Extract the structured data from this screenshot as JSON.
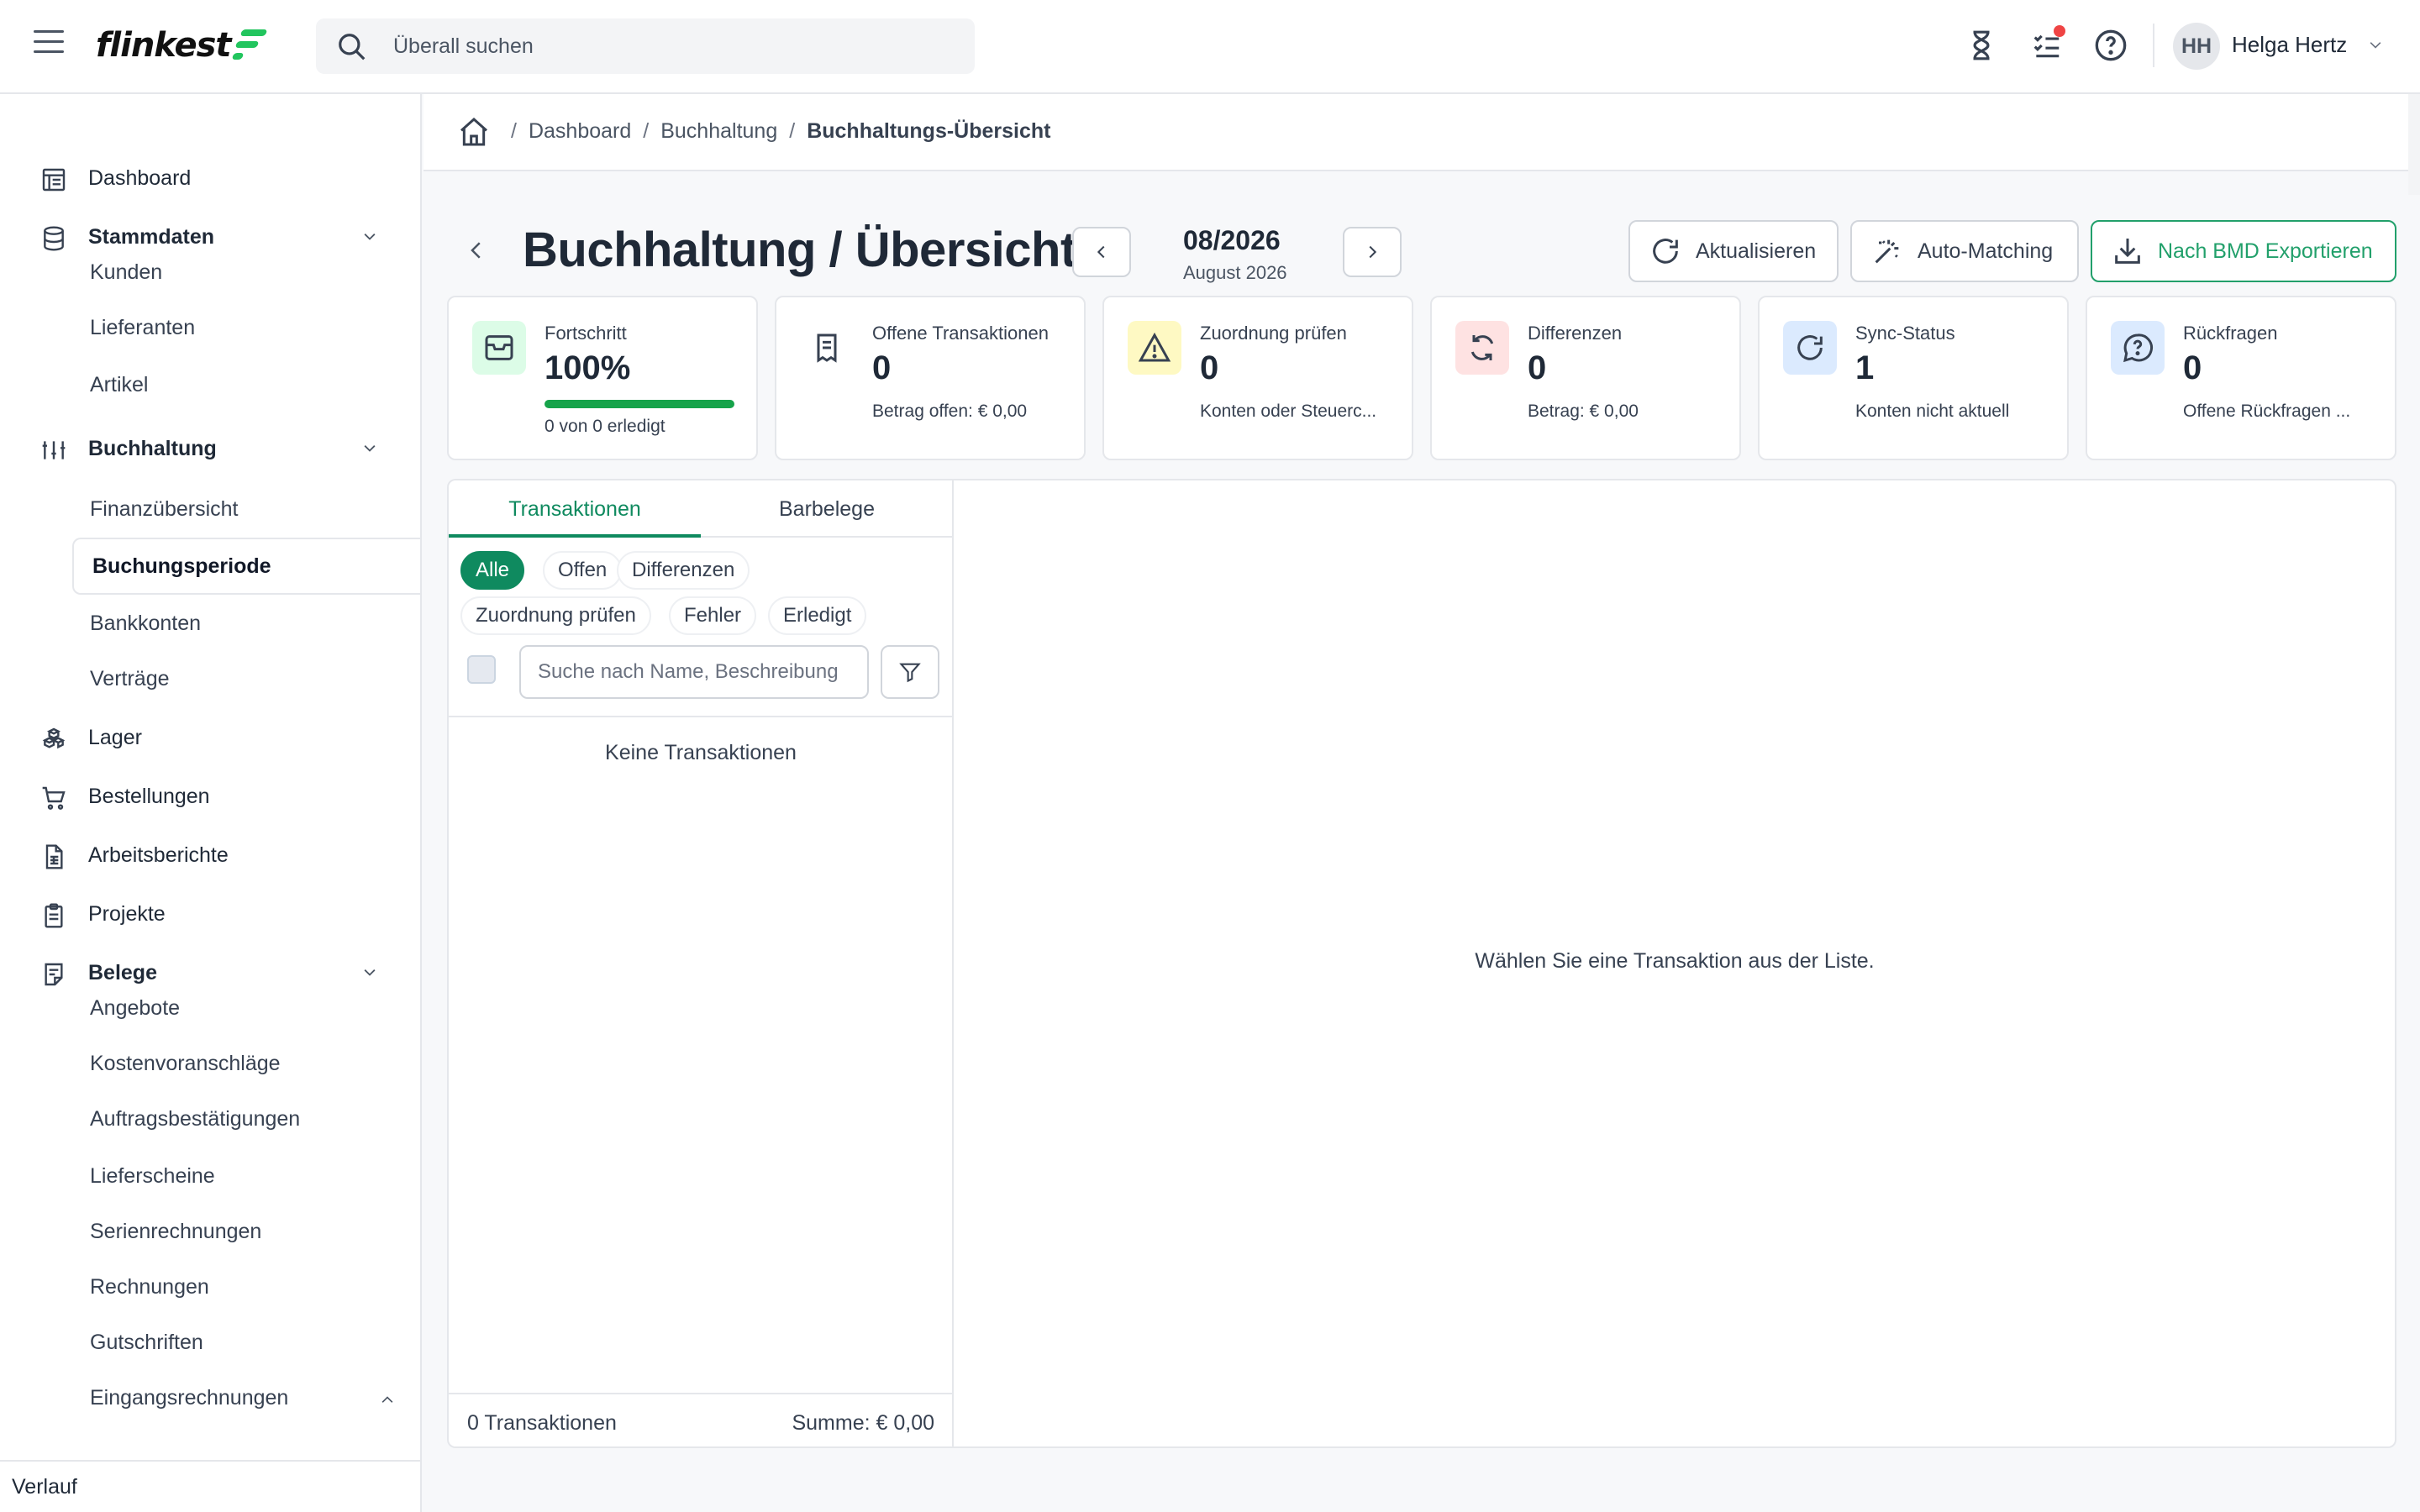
{
  "header": {
    "logo_text": "flinkest",
    "search_placeholder": "Überall suchen",
    "user_initials": "HH",
    "user_name": "Helga Hertz"
  },
  "sidebar": {
    "items": [
      {
        "label": "Dashboard",
        "icon": "dashboard-icon"
      },
      {
        "label": "Stammdaten",
        "icon": "database-icon",
        "expanded": true
      },
      {
        "label": "Kunden"
      },
      {
        "label": "Lieferanten"
      },
      {
        "label": "Artikel"
      },
      {
        "label": "Buchhaltung",
        "icon": "sliders-icon",
        "expanded": true
      },
      {
        "label": "Finanzübersicht"
      },
      {
        "label": "Buchungsperiode",
        "active": true
      },
      {
        "label": "Bankkonten"
      },
      {
        "label": "Verträge"
      },
      {
        "label": "Lager",
        "icon": "boxes-icon"
      },
      {
        "label": "Bestellungen",
        "icon": "cart-icon"
      },
      {
        "label": "Arbeitsberichte",
        "icon": "report-icon"
      },
      {
        "label": "Projekte",
        "icon": "clipboard-icon"
      },
      {
        "label": "Belege",
        "icon": "receipt-icon",
        "expanded": true
      },
      {
        "label": "Angebote"
      },
      {
        "label": "Kostenvoranschläge"
      },
      {
        "label": "Auftragsbestätigungen"
      },
      {
        "label": "Lieferscheine"
      },
      {
        "label": "Serienrechnungen"
      },
      {
        "label": "Rechnungen"
      },
      {
        "label": "Gutschriften"
      },
      {
        "label": "Eingangsrechnungen"
      }
    ],
    "footer_label": "Verlauf"
  },
  "breadcrumb": {
    "items": [
      "Dashboard",
      "Buchhaltung",
      "Buchhaltungs-Übersicht"
    ],
    "separator": "/"
  },
  "page": {
    "title": "Buchhaltung / Übersicht",
    "period": "08/2026",
    "period_label": "August 2026",
    "actions": {
      "refresh": "Aktualisieren",
      "auto_matching": "Auto-Matching",
      "export": "Nach BMD Exportieren"
    }
  },
  "stats": [
    {
      "title": "Fortschritt",
      "value": "100%",
      "sub": "0 von 0 erledigt",
      "progress": 1.0,
      "color": "#dcfce7",
      "icon": "inbox-icon"
    },
    {
      "title": "Offene Transaktionen",
      "value": "0",
      "sub": "Betrag offen: € 0,00",
      "color": "#ffffff",
      "icon": "receipt-icon"
    },
    {
      "title": "Zuordnung prüfen",
      "value": "0",
      "sub": "Konten oder Steuerc...",
      "color": "#fef9c3",
      "icon": "warning-icon"
    },
    {
      "title": "Differenzen",
      "value": "0",
      "sub": "Betrag: € 0,00",
      "color": "#fee2e2",
      "icon": "sync-icon"
    },
    {
      "title": "Sync-Status",
      "value": "1",
      "sub": "Konten nicht aktuell",
      "color": "#dbeafe",
      "icon": "refresh-icon"
    },
    {
      "title": "Rückfragen",
      "value": "0",
      "sub": "Offene Rückfragen ...",
      "color": "#dbeafe",
      "icon": "question-bubble-icon"
    }
  ],
  "list": {
    "tabs": [
      "Transaktionen",
      "Barbelege"
    ],
    "filters": [
      "Alle",
      "Offen",
      "Differenzen",
      "Zuordnung prüfen",
      "Fehler",
      "Erledigt"
    ],
    "search_placeholder": "Suche nach Name, Beschreibung",
    "empty_text": "Keine Transaktionen",
    "count_label": "0 Transaktionen",
    "sum_label": "Summe: € 0,00"
  },
  "detail": {
    "empty_text": "Wählen Sie eine Transaktion aus der Liste."
  },
  "colors": {
    "accent": "#0f8a5f",
    "export": "#22a06b"
  }
}
